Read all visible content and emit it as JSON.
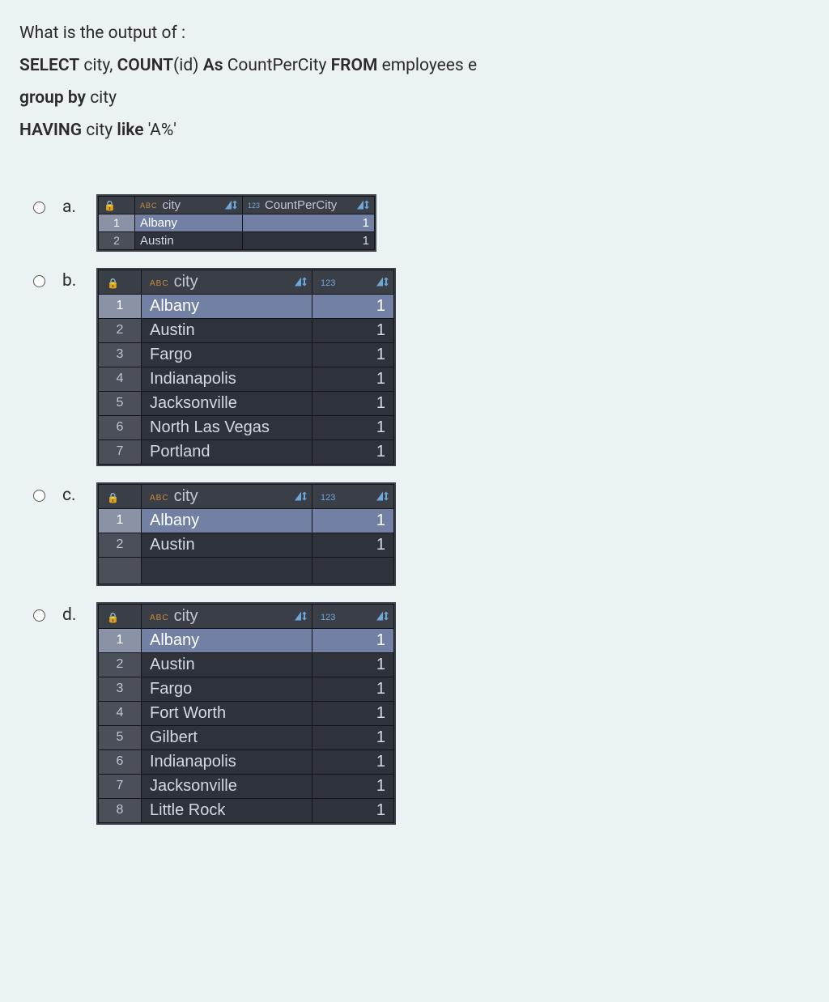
{
  "question": {
    "line1_pre": "What is the output of :",
    "sql": {
      "select": "SELECT",
      "city1": " city, ",
      "count": "COUNT",
      "id": "(id) ",
      "as": "As",
      "alias": " CountPerCity  ",
      "from": "FROM",
      "emp": " employees e",
      "groupby": "group by",
      "city2": " city",
      "having": "HAVING",
      "city3": " city ",
      "like": "like",
      "lit": " 'A%'"
    }
  },
  "labels": {
    "a": "a.",
    "b": "b.",
    "c": "c.",
    "d": "d."
  },
  "headers": {
    "city": "city",
    "cpc": "CountPerCity",
    "abc": "ABC",
    "num": "123"
  },
  "a": {
    "rows": [
      {
        "n": "1",
        "city": "Albany",
        "v": "1",
        "sel": true
      },
      {
        "n": "2",
        "city": "Austin",
        "v": "1"
      }
    ]
  },
  "b": {
    "rows": [
      {
        "n": "1",
        "city": "Albany",
        "v": "1",
        "sel": true
      },
      {
        "n": "2",
        "city": "Austin",
        "v": "1"
      },
      {
        "n": "3",
        "city": "Fargo",
        "v": "1"
      },
      {
        "n": "4",
        "city": "Indianapolis",
        "v": "1"
      },
      {
        "n": "5",
        "city": "Jacksonville",
        "v": "1"
      },
      {
        "n": "6",
        "city": "North Las Vegas",
        "v": "1"
      },
      {
        "n": "7",
        "city": "Portland",
        "v": "1"
      }
    ]
  },
  "c": {
    "rows": [
      {
        "n": "1",
        "city": "Albany",
        "v": "1",
        "sel": true
      },
      {
        "n": "2",
        "city": "Austin",
        "v": "1"
      },
      {
        "n": "",
        "city": "",
        "v": "",
        "empty": true
      }
    ]
  },
  "d": {
    "rows": [
      {
        "n": "1",
        "city": "Albany",
        "v": "1",
        "sel": true
      },
      {
        "n": "2",
        "city": "Austin",
        "v": "1"
      },
      {
        "n": "3",
        "city": "Fargo",
        "v": "1"
      },
      {
        "n": "4",
        "city": "Fort Worth",
        "v": "1"
      },
      {
        "n": "5",
        "city": "Gilbert",
        "v": "1"
      },
      {
        "n": "6",
        "city": "Indianapolis",
        "v": "1"
      },
      {
        "n": "7",
        "city": "Jacksonville",
        "v": "1"
      },
      {
        "n": "8",
        "city": "Little Rock",
        "v": "1"
      }
    ]
  }
}
